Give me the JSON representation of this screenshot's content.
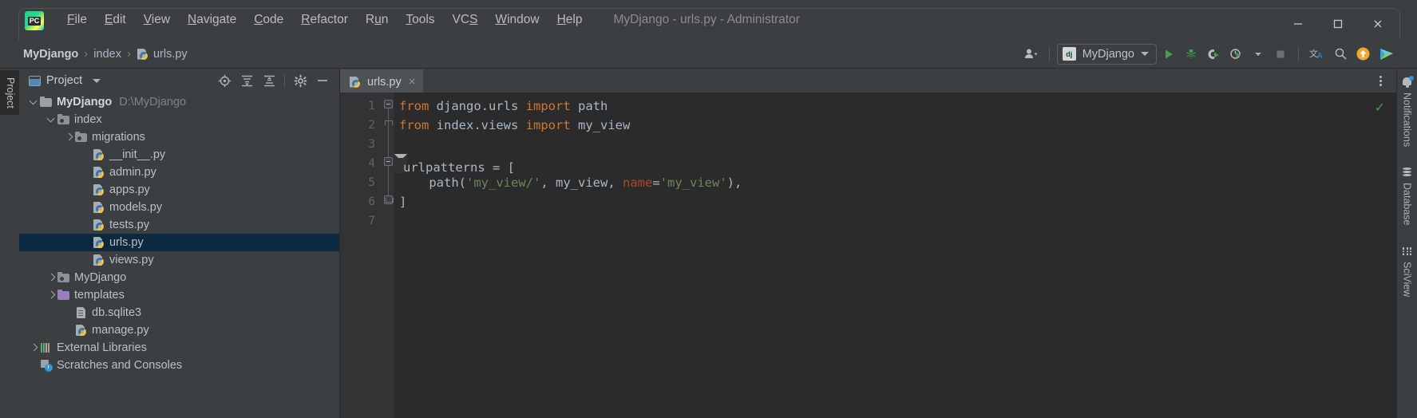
{
  "window": {
    "title": "MyDjango - urls.py - Administrator",
    "app_icon": "pycharm-logo-icon",
    "controls": {
      "minimize": "minimize-icon",
      "maximize": "maximize-icon",
      "close": "close-icon"
    }
  },
  "menubar": [
    {
      "label": "File",
      "mnemonic": "F"
    },
    {
      "label": "Edit",
      "mnemonic": "E"
    },
    {
      "label": "View",
      "mnemonic": "V"
    },
    {
      "label": "Navigate",
      "mnemonic": "N"
    },
    {
      "label": "Code",
      "mnemonic": "C"
    },
    {
      "label": "Refactor",
      "mnemonic": "R"
    },
    {
      "label": "Run",
      "mnemonic": "u"
    },
    {
      "label": "Tools",
      "mnemonic": "T"
    },
    {
      "label": "VCS",
      "mnemonic": "S"
    },
    {
      "label": "Window",
      "mnemonic": "W"
    },
    {
      "label": "Help",
      "mnemonic": "H"
    }
  ],
  "navbar": {
    "breadcrumbs": [
      {
        "label": "MyDjango",
        "icon": ""
      },
      {
        "label": "index",
        "icon": ""
      },
      {
        "label": "urls.py",
        "icon": "python-file-icon"
      }
    ],
    "separator": "›",
    "run_config": {
      "label": "MyDjango",
      "icon": "django-icon"
    },
    "buttons": [
      {
        "name": "user-avatar-button",
        "icon": "user-icon"
      },
      {
        "name": "run-button",
        "icon": "run-play-icon"
      },
      {
        "name": "debug-button",
        "icon": "debug-bug-icon"
      },
      {
        "name": "run-coverage-button",
        "icon": "coverage-icon"
      },
      {
        "name": "profiler-button",
        "icon": "profiler-clock-icon"
      },
      {
        "name": "stop-button",
        "icon": "stop-square-icon"
      },
      {
        "name": "translate-button",
        "icon": "translate-icon"
      },
      {
        "name": "search-everywhere-button",
        "icon": "search-icon"
      },
      {
        "name": "update-button",
        "icon": "arrow-up-circle-icon"
      },
      {
        "name": "share-button",
        "icon": "play-colored-icon"
      }
    ]
  },
  "left_strip": {
    "project_tab": "Project"
  },
  "project_panel": {
    "title": "Project",
    "header_buttons": [
      {
        "name": "select-opened-file-button",
        "icon": "crosshair-icon"
      },
      {
        "name": "expand-all-button",
        "icon": "expand-all-icon"
      },
      {
        "name": "collapse-all-button",
        "icon": "collapse-all-icon"
      },
      {
        "name": "settings-button",
        "icon": "gear-icon"
      },
      {
        "name": "hide-button",
        "icon": "minimize-icon"
      }
    ],
    "tree": [
      {
        "label": "MyDjango",
        "path": "D:\\MyDjango",
        "indent": 0,
        "arrow": "open",
        "icon": "folder",
        "bold": true,
        "selected": false
      },
      {
        "label": "index",
        "indent": 1,
        "arrow": "open",
        "icon": "folder-module",
        "selected": false
      },
      {
        "label": "migrations",
        "indent": 2,
        "arrow": "closed",
        "icon": "folder-module",
        "selected": false
      },
      {
        "label": "__init__.py",
        "indent": 3,
        "arrow": "none",
        "icon": "python-file",
        "selected": false
      },
      {
        "label": "admin.py",
        "indent": 3,
        "arrow": "none",
        "icon": "python-file",
        "selected": false
      },
      {
        "label": "apps.py",
        "indent": 3,
        "arrow": "none",
        "icon": "python-file",
        "selected": false
      },
      {
        "label": "models.py",
        "indent": 3,
        "arrow": "none",
        "icon": "python-file",
        "selected": false
      },
      {
        "label": "tests.py",
        "indent": 3,
        "arrow": "none",
        "icon": "python-file",
        "selected": false
      },
      {
        "label": "urls.py",
        "indent": 3,
        "arrow": "none",
        "icon": "python-file",
        "selected": true
      },
      {
        "label": "views.py",
        "indent": 3,
        "arrow": "none",
        "icon": "python-file",
        "selected": false
      },
      {
        "label": "MyDjango",
        "indent": 1,
        "arrow": "closed",
        "icon": "folder-module",
        "selected": false
      },
      {
        "label": "templates",
        "indent": 1,
        "arrow": "closed",
        "icon": "folder-purple",
        "selected": false
      },
      {
        "label": "db.sqlite3",
        "indent": 2,
        "arrow": "none",
        "icon": "db-file",
        "selected": false
      },
      {
        "label": "manage.py",
        "indent": 2,
        "arrow": "none",
        "icon": "python-file",
        "selected": false
      },
      {
        "label": "External Libraries",
        "indent": 0,
        "arrow": "closed",
        "icon": "libraries",
        "selected": false
      },
      {
        "label": "Scratches and Consoles",
        "indent": 0,
        "arrow": "none",
        "icon": "scratches",
        "selected": false
      }
    ]
  },
  "editor": {
    "tab": {
      "label": "urls.py",
      "icon": "python-file-icon",
      "close": "×"
    },
    "options_icon": "more-options-icon",
    "inspection_status": "✓",
    "line_numbers": [
      "1",
      "2",
      "3",
      "4",
      "5",
      "6",
      "7"
    ],
    "caret_line": 4,
    "lines": [
      {
        "n": 1,
        "tokens": [
          {
            "t": "from",
            "c": "k"
          },
          {
            "t": " django.urls ",
            "c": "id"
          },
          {
            "t": "import",
            "c": "k"
          },
          {
            "t": " path",
            "c": "id"
          }
        ]
      },
      {
        "n": 2,
        "tokens": [
          {
            "t": "from",
            "c": "k"
          },
          {
            "t": " index.views ",
            "c": "id"
          },
          {
            "t": "import",
            "c": "k"
          },
          {
            "t": " my_view",
            "c": "id"
          }
        ]
      },
      {
        "n": 3,
        "tokens": []
      },
      {
        "n": 4,
        "tokens": [
          {
            "t": "urlpatterns ",
            "c": "id"
          },
          {
            "t": "=",
            "c": "op"
          },
          {
            "t": " [",
            "c": "id"
          }
        ]
      },
      {
        "n": 5,
        "tokens": [
          {
            "t": "    path(",
            "c": "id"
          },
          {
            "t": "'my_view/'",
            "c": "s"
          },
          {
            "t": ", my_view, ",
            "c": "id"
          },
          {
            "t": "name",
            "c": "kw"
          },
          {
            "t": "=",
            "c": "op"
          },
          {
            "t": "'my_view'",
            "c": "s"
          },
          {
            "t": "),",
            "c": "id"
          }
        ]
      },
      {
        "n": 6,
        "tokens": [
          {
            "t": "]",
            "c": "id"
          }
        ]
      },
      {
        "n": 7,
        "tokens": []
      }
    ]
  },
  "right_strip": [
    {
      "label": "Notifications",
      "icon": "bell-icon",
      "badge": true
    },
    {
      "label": "Database",
      "icon": "database-icon",
      "badge": false
    },
    {
      "label": "SciView",
      "icon": "sciview-grid-icon",
      "badge": false
    }
  ],
  "colors": {
    "bg_chrome": "#3c3f41",
    "bg_editor": "#2b2b2b",
    "selection": "#0d293f",
    "keyword": "#cc7832",
    "string": "#6a8759",
    "identifier": "#a9b7c6",
    "named_arg": "#aa4926",
    "accent_green": "#499c54",
    "accent_orange": "#f5a623",
    "accent_blue": "#3592e0"
  }
}
